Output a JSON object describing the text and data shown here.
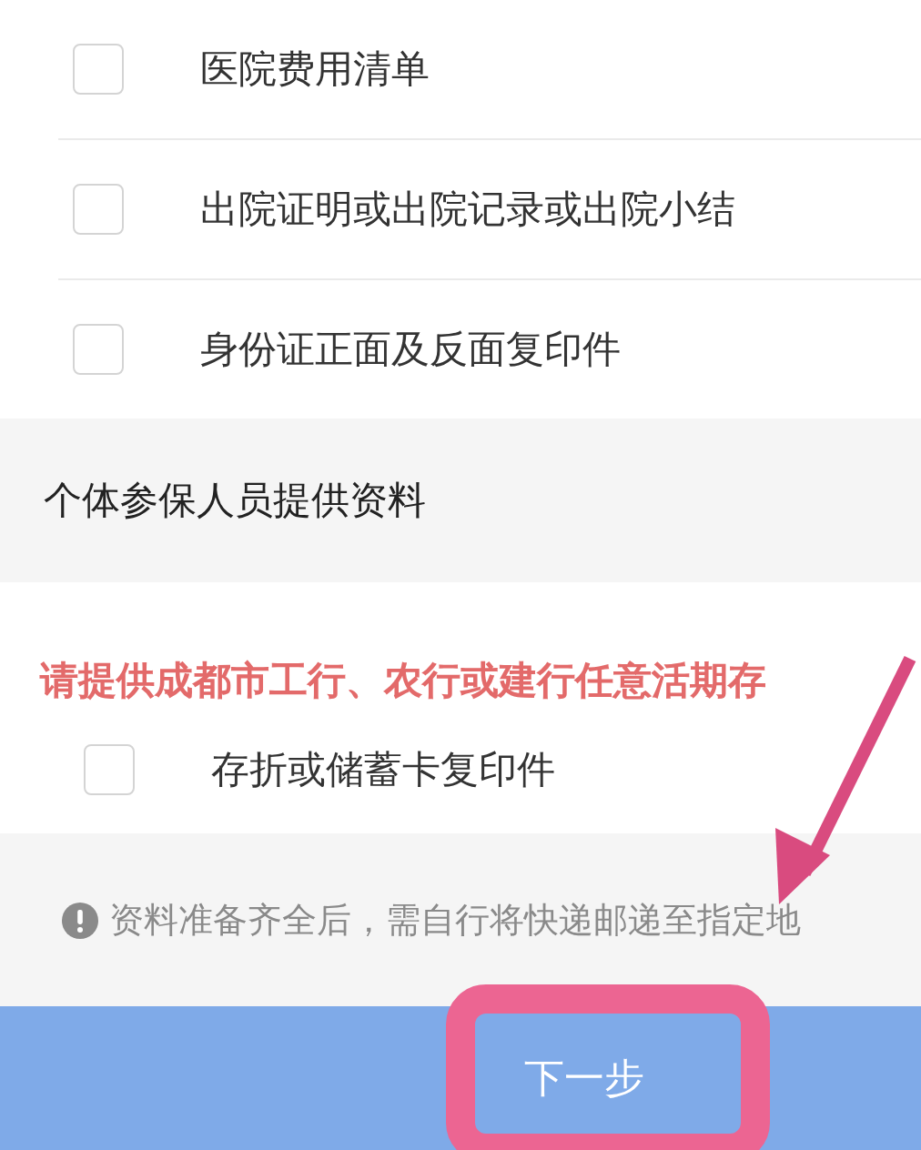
{
  "documents": [
    {
      "label": "医院费用清单",
      "checked": false
    },
    {
      "label": "出院证明或出院记录或出院小结",
      "checked": false
    },
    {
      "label": "身份证正面及反面复印件",
      "checked": false
    }
  ],
  "section": {
    "title": "个体参保人员提供资料",
    "note": "请提供成都市工行、农行或建行任意活期存",
    "items": [
      {
        "label": "存折或储蓄卡复印件",
        "checked": false
      }
    ]
  },
  "notice": "资料准备齐全后，需自行将快递邮递至指定地",
  "next_button": "下一步"
}
